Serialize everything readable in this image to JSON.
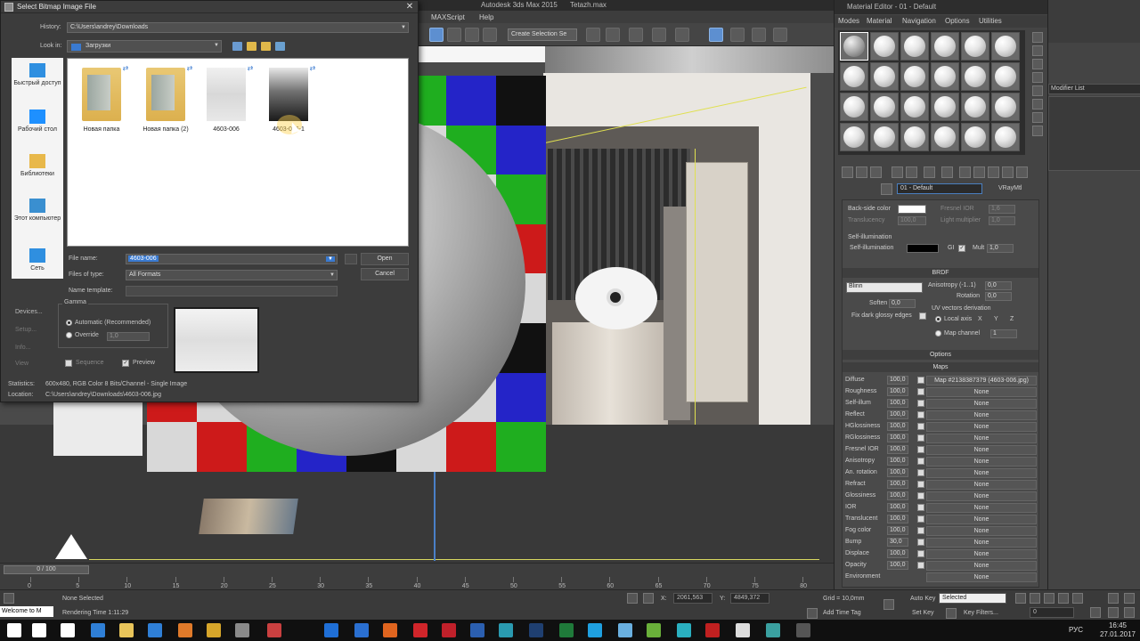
{
  "max_window": {
    "app_title": "Autodesk 3ds Max 2015",
    "file_name": "Tetazh.max",
    "menu": [
      "MAXScript",
      "Help"
    ],
    "selection_set_placeholder": "Create Selection Se"
  },
  "viewport": {
    "checker_colors": [
      "#cd1a1a",
      "#1fae1f",
      "#2424c8",
      "#111111",
      "#d8d8d8"
    ],
    "checker_rows": [
      [
        "#d8d8d8",
        "#1fae1f",
        "#2424c8",
        "#111111",
        "#d8d8d8",
        "#1fae1f",
        "#2424c8",
        "#111111"
      ],
      [
        "#cd1a1a",
        "#d8d8d8",
        "#1fae1f",
        "#2424c8",
        "#111111",
        "#d8d8d8",
        "#1fae1f",
        "#2424c8"
      ],
      [
        "#111111",
        "#cd1a1a",
        "#d8d8d8",
        "#1fae1f",
        "#2424c8",
        "#111111",
        "#d8d8d8",
        "#1fae1f"
      ],
      [
        "#2424c8",
        "#111111",
        "#cd1a1a",
        "#d8d8d8",
        "#1fae1f",
        "#2424c8",
        "#111111",
        "#cd1a1a"
      ],
      [
        "#1fae1f",
        "#2424c8",
        "#111111",
        "#cd1a1a",
        "#d8d8d8",
        "#1fae1f",
        "#2424c8",
        "#d8d8d8"
      ],
      [
        "#d8d8d8",
        "#1fae1f",
        "#2424c8",
        "#111111",
        "#cd1a1a",
        "#d8d8d8",
        "#1fae1f",
        "#111111"
      ],
      [
        "#cd1a1a",
        "#d8d8d8",
        "#1fae1f",
        "#2424c8",
        "#111111",
        "#cd1a1a",
        "#d8d8d8",
        "#2424c8"
      ],
      [
        "#d8d8d8",
        "#cd1a1a",
        "#1fae1f",
        "#2424c8",
        "#111111",
        "#d8d8d8",
        "#cd1a1a",
        "#1fae1f"
      ]
    ]
  },
  "timeline": {
    "slider_label": "0 / 100",
    "ticks": [
      "0",
      "5",
      "10",
      "15",
      "20",
      "25",
      "30",
      "35",
      "40",
      "45",
      "50",
      "55",
      "60",
      "65",
      "70",
      "75",
      "80",
      "85"
    ]
  },
  "status": {
    "script_listener": "Welcome to M",
    "selection": "None Selected",
    "rendering_time": "Rendering Time  1:11:29",
    "x_label": "X:",
    "x_value": "2061,563",
    "y_label": "Y:",
    "y_value": "4849,372",
    "grid": "Grid = 10,0mm",
    "auto_key": "Auto Key",
    "auto_key_mode": "Selected",
    "set_key": "Set Key",
    "key_filters": "Key Filters...",
    "frame_value": "0",
    "add_time_tag": "Add Time Tag"
  },
  "taskbar": {
    "language": "РУС",
    "time": "16:45",
    "date": "27.01.2017",
    "app_icons": [
      {
        "name": "windows-start-icon",
        "color": "#ffffff"
      },
      {
        "name": "search-icon",
        "color": "#ffffff"
      },
      {
        "name": "task-view-icon",
        "color": "#ffffff"
      },
      {
        "name": "edge-icon",
        "color": "#2f7fd6"
      },
      {
        "name": "file-explorer-icon",
        "color": "#e8c45a"
      },
      {
        "name": "store-icon",
        "color": "#2f7fd6"
      },
      {
        "name": "app-orange-icon",
        "color": "#e07a2a"
      },
      {
        "name": "app-yellow-icon",
        "color": "#d6a52a"
      },
      {
        "name": "app-gray-icon",
        "color": "#8a8a8a"
      },
      {
        "name": "app-multi-icon",
        "color": "#c94040"
      },
      {
        "name": "app-blue-circle-icon",
        "color": "#1f6fd6"
      },
      {
        "name": "app-blue-icon",
        "color": "#2a6fd0"
      },
      {
        "name": "firefox-icon",
        "color": "#e0651f"
      },
      {
        "name": "opera-icon",
        "color": "#d0252a"
      },
      {
        "name": "acrobat-icon",
        "color": "#c0202a"
      },
      {
        "name": "word-icon",
        "color": "#2b5fb0"
      },
      {
        "name": "app-teal-icon",
        "color": "#2a9ab0"
      },
      {
        "name": "photoshop-icon",
        "color": "#1f3f70"
      },
      {
        "name": "excel-icon",
        "color": "#1f7a3a"
      },
      {
        "name": "skype-icon",
        "color": "#1fa0e0"
      },
      {
        "name": "app-lightblue-icon",
        "color": "#6ab0e0"
      },
      {
        "name": "app-lime-icon",
        "color": "#6ab03a"
      },
      {
        "name": "app-cyan-icon",
        "color": "#2ab0c0"
      },
      {
        "name": "filezilla-icon",
        "color": "#c02020"
      },
      {
        "name": "app-white-icon",
        "color": "#dddddd"
      },
      {
        "name": "3dsmax-icon",
        "color": "#3aa0a0"
      },
      {
        "name": "app-dark-icon",
        "color": "#555555"
      }
    ]
  },
  "material_editor": {
    "title": "Material Editor - 01 - Default",
    "menu": [
      "Modes",
      "Material",
      "Navigation",
      "Options",
      "Utilities"
    ],
    "material_name": "01 - Default",
    "material_type": "VRayMtl",
    "params": {
      "back_side_color": "Back-side color",
      "fresnel_ior": "Fresnel IOR",
      "fresnel_ior_value": "1,6",
      "reflect_ior": "Reflect IOR",
      "reflect_ior_value": "1,6",
      "translucency": "Translucency",
      "translucency_value": "100,0",
      "light_multiplier": "Light multiplier",
      "light_multiplier_value": "1,0",
      "self_illumination_header": "Self-illumination",
      "self_illumination": "Self-illumination",
      "gi": "GI",
      "mult": "Mult",
      "mult_value": "1,0"
    },
    "brdf": {
      "title": "BRDF",
      "type": "Blinn",
      "anisotropy": "Anisotropy (-1..1)",
      "anisotropy_value": "0,0",
      "rotation": "Rotation",
      "rotation_value": "0,0",
      "soften": "Soften",
      "soften_value": "0,0",
      "fix_dark": "Fix dark glossy edges",
      "uv_vectors": "UV vectors derivation",
      "local_axis": "Local axis",
      "axis_x": "X",
      "axis_y": "Y",
      "axis_z": "Z",
      "map_channel": "Map channel",
      "map_channel_value": "1"
    },
    "options_title": "Options",
    "maps_title": "Maps",
    "maps": [
      {
        "name": "Diffuse",
        "value": "100,0",
        "map": "Map #2138387379 (4603-006.jpg)"
      },
      {
        "name": "Roughness",
        "value": "100,0",
        "map": "None"
      },
      {
        "name": "Self-illum",
        "value": "100,0",
        "map": "None"
      },
      {
        "name": "Reflect",
        "value": "100,0",
        "map": "None"
      },
      {
        "name": "HGlossiness",
        "value": "100,0",
        "map": "None"
      },
      {
        "name": "RGlossiness",
        "value": "100,0",
        "map": "None"
      },
      {
        "name": "Fresnel IOR",
        "value": "100,0",
        "map": "None"
      },
      {
        "name": "Anisotropy",
        "value": "100,0",
        "map": "None"
      },
      {
        "name": "An. rotation",
        "value": "100,0",
        "map": "None"
      },
      {
        "name": "Refract",
        "value": "100,0",
        "map": "None"
      },
      {
        "name": "Glossiness",
        "value": "100,0",
        "map": "None"
      },
      {
        "name": "IOR",
        "value": "100,0",
        "map": "None"
      },
      {
        "name": "Translucent",
        "value": "100,0",
        "map": "None"
      },
      {
        "name": "Fog color",
        "value": "100,0",
        "map": "None"
      },
      {
        "name": "Bump",
        "value": "30,0",
        "map": "None"
      },
      {
        "name": "Displace",
        "value": "100,0",
        "map": "None"
      },
      {
        "name": "Opacity",
        "value": "100,0",
        "map": "None"
      },
      {
        "name": "Environment",
        "value": "",
        "map": "None"
      }
    ]
  },
  "command_panel": {
    "modifier_list": "Modifier List"
  },
  "dialog": {
    "title": "Select Bitmap Image File",
    "close": "✕",
    "history_label": "History:",
    "history_value": "C:\\Users\\andrey\\Downloads",
    "lookin_label": "Look in:",
    "lookin_value": "Загрузки",
    "places": [
      {
        "label": "Быстрый доступ",
        "icon": "quick-access-icon"
      },
      {
        "label": "Рабочий стол",
        "icon": "desktop-icon"
      },
      {
        "label": "Библиотеки",
        "icon": "libraries-icon"
      },
      {
        "label": "Этот компьютер",
        "icon": "this-pc-icon"
      },
      {
        "label": "Сеть",
        "icon": "network-icon"
      }
    ],
    "files": [
      {
        "label": "Новая папка",
        "kind": "folder"
      },
      {
        "label": "Новая папка (2)",
        "kind": "folder"
      },
      {
        "label": "4603-006",
        "kind": "image-light"
      },
      {
        "label": "4603-006-1",
        "kind": "image-dark"
      }
    ],
    "file_name_label": "File name:",
    "file_name_value": "4603-006",
    "files_of_type_label": "Files of type:",
    "files_of_type_value": "All Formats",
    "name_template_label": "Name template:",
    "open_button": "Open",
    "cancel_button": "Cancel",
    "devices_button": "Devices...",
    "setup_button": "Setup...",
    "info_button": "Info...",
    "view_button": "View",
    "gamma_title": "Gamma",
    "gamma_auto": "Automatic (Recommended)",
    "gamma_override": "Override",
    "gamma_override_value": "1,0",
    "sequence_label": "Sequence",
    "preview_label": "Preview",
    "statistics_label": "Statistics:",
    "statistics_value": "600x480, RGB Color 8 Bits/Channel - Single Image",
    "location_label": "Location:",
    "location_value": "C:\\Users\\andrey\\Downloads\\4603-006.jpg"
  }
}
